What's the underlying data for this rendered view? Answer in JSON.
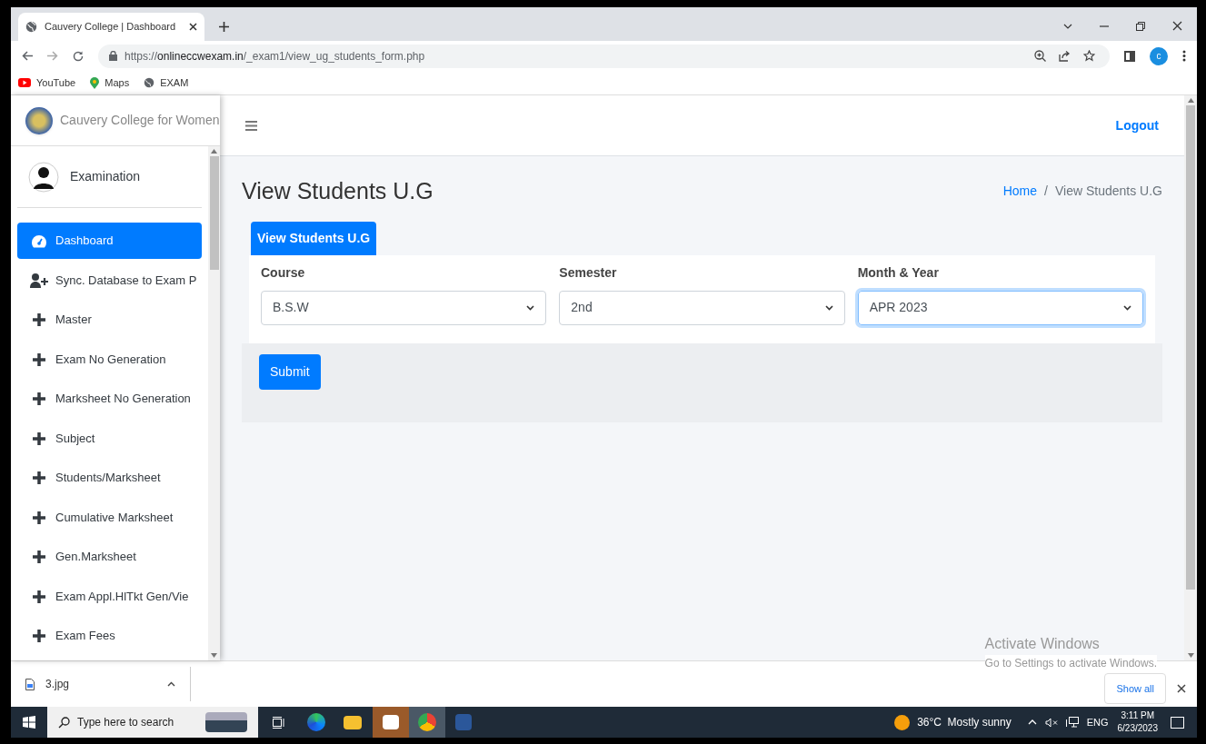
{
  "browser": {
    "tab_title": "Cauvery College | Dashboard",
    "url_host": "onlineccwexam.in",
    "url_scheme": "https://",
    "url_path": "/_exam1/view_ug_students_form.php",
    "profile_initial": "c",
    "bookmarks": [
      "YouTube",
      "Maps",
      "EXAM"
    ]
  },
  "sidebar": {
    "brand": "Cauvery College for Women",
    "user": "Examination",
    "items": [
      {
        "label": "Dashboard",
        "kind": "dashboard",
        "selected": true
      },
      {
        "label": "Sync. Database to Exam P",
        "kind": "sync",
        "selected": false
      },
      {
        "label": "Master",
        "kind": "menu",
        "selected": false
      },
      {
        "label": "Exam No Generation",
        "kind": "menu",
        "selected": false
      },
      {
        "label": "Marksheet No Generation",
        "kind": "menu",
        "selected": false
      },
      {
        "label": "Subject",
        "kind": "menu",
        "selected": false
      },
      {
        "label": "Students/Marksheet",
        "kind": "menu",
        "selected": false
      },
      {
        "label": "Cumulative Marksheet",
        "kind": "menu",
        "selected": false
      },
      {
        "label": "Gen.Marksheet",
        "kind": "menu",
        "selected": false
      },
      {
        "label": "Exam Appl.HlTkt Gen/Vie",
        "kind": "menu",
        "selected": false
      },
      {
        "label": "Exam Fees",
        "kind": "menu",
        "selected": false
      }
    ]
  },
  "header": {
    "logout": "Logout"
  },
  "page": {
    "title": "View Students U.G",
    "breadcrumb": [
      "Home",
      "View Students U.G"
    ],
    "breadcrumb_separator": "/",
    "card_tab": "View Students U.G",
    "fields": [
      {
        "label": "Course",
        "value": "B.S.W",
        "focused": false
      },
      {
        "label": "Semester",
        "value": "2nd",
        "focused": false
      },
      {
        "label": "Month & Year",
        "value": "APR 2023",
        "focused": true
      }
    ],
    "submit": "Submit"
  },
  "overlay": {
    "title": "Activate Windows",
    "subtitle": "Go to Settings to activate Windows."
  },
  "downloads": {
    "file": "3.jpg",
    "show_all": "Show all"
  },
  "taskbar": {
    "search_placeholder": "Type here to search",
    "weather": "36°C  Mostly sunny",
    "language": "ENG",
    "time": "3:11 PM",
    "date": "6/23/2023"
  }
}
